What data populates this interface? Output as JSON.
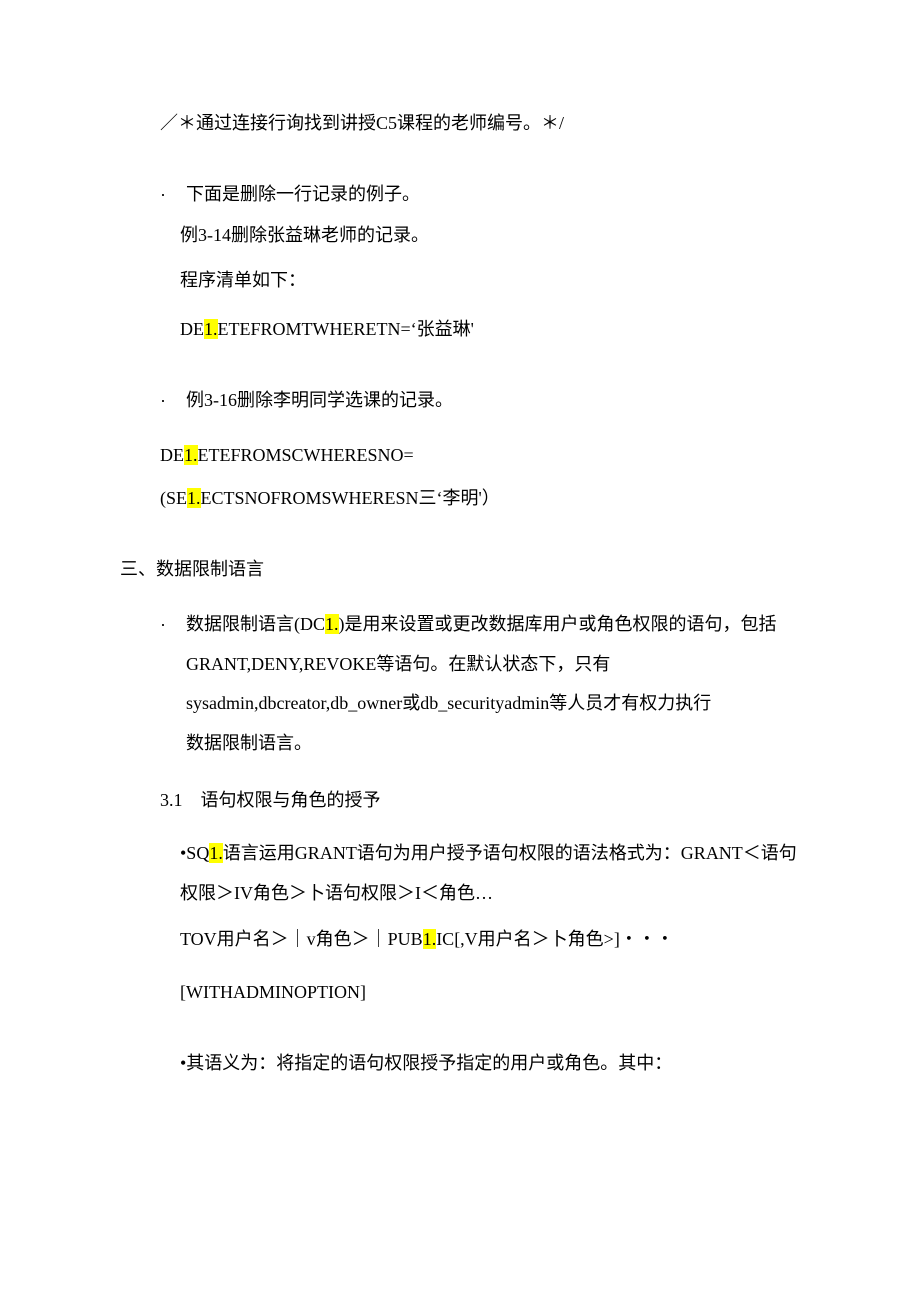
{
  "line1": "／＊通过连接行询找到讲授C5课程的老师编号。＊/",
  "bullet2": "·",
  "line2": "下面是删除一行记录的例子。",
  "line3": "例3-14删除张益琳老师的记录。",
  "line4": "程序清单如下：",
  "line5a": "DE",
  "line5hl": "1.",
  "line5b": "ETEFROMTWHERETN=‘张益琳'",
  "bullet6": "·",
  "line6": "例3-16删除李明同学选课的记录。",
  "line7a": "DE",
  "line7hl": "1.",
  "line7b": "ETEFROMSCWHERESNO=",
  "line8a": "(SE",
  "line8hl": "1.",
  "line8b": "ECTSNOFROMSWHERESN三‘李明'）",
  "sec3": "三、数据限制语言",
  "bullet9": "·",
  "line9a": "数据限制语言(DC",
  "line9hl": "1.",
  "line9b": ")是用来设置或更改数据库用户或角色权限的语句，包括",
  "line10": "GRANT,DENY,REVOKE等语句。在默认状态下，只有",
  "line11": "sysadmin,dbcreator,db_owner或db_securityadmin等人员才有权力执行",
  "line12": "数据限制语言。",
  "head31": "3.1　语句权限与角色的授予",
  "line13a": "•SQ",
  "line13hl": "1.",
  "line13b": "语言运用GRANT语句为用户授予语句权限的语法格式为：GRANT＜语句",
  "line14": "权限＞IV角色＞卜语句权限＞I＜角色…",
  "line15a": "TOV用户名＞｜v角色＞｜PUB",
  "line15hl": "1.",
  "line15b": "IC[,V用户名＞卜角色>]・・・",
  "line16": "[WITHADMINOPTION]",
  "line17": "•其语义为：将指定的语句权限授予指定的用户或角色。其中："
}
